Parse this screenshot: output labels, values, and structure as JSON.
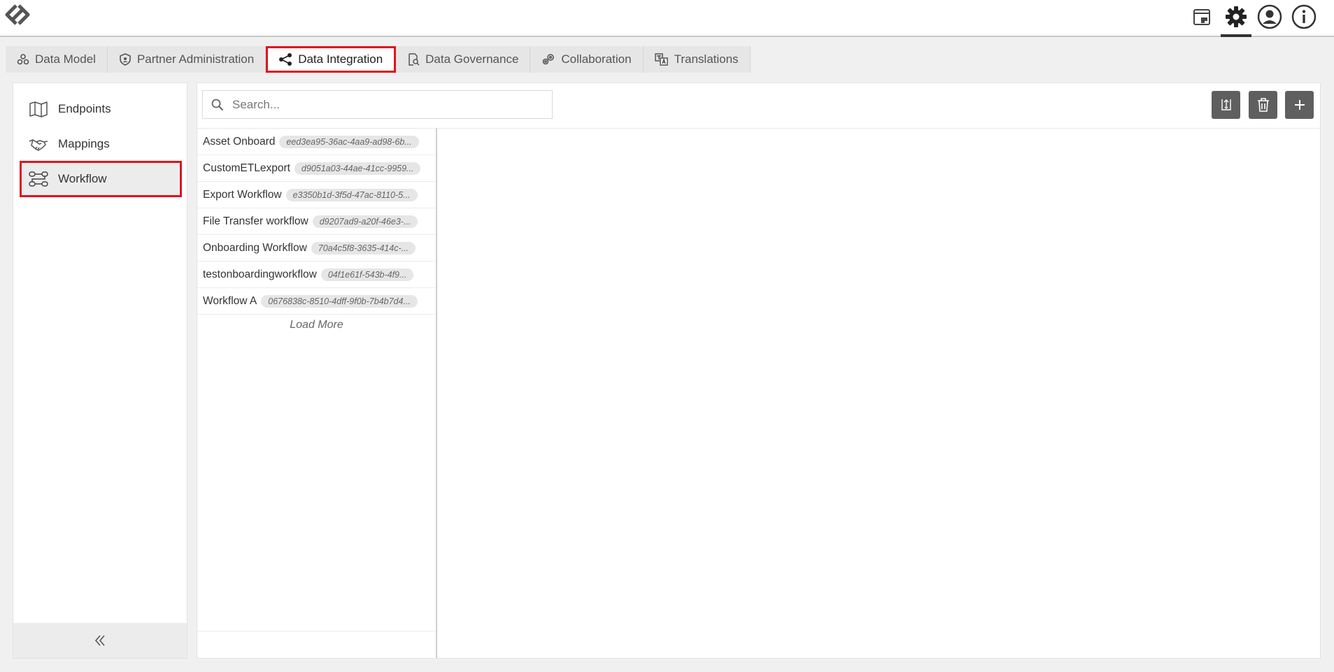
{
  "tabs": [
    {
      "label": "Data Model",
      "icon": "data-model-icon"
    },
    {
      "label": "Partner Administration",
      "icon": "shield-icon"
    },
    {
      "label": "Data Integration",
      "icon": "share-nodes-icon"
    },
    {
      "label": "Data Governance",
      "icon": "document-search-icon"
    },
    {
      "label": "Collaboration",
      "icon": "gears-icon"
    },
    {
      "label": "Translations",
      "icon": "translate-icon"
    }
  ],
  "active_tab": "Data Integration",
  "sidebar": {
    "items": [
      {
        "label": "Endpoints",
        "icon": "map-icon"
      },
      {
        "label": "Mappings",
        "icon": "handshake-icon"
      },
      {
        "label": "Workflow",
        "icon": "workflow-icon"
      }
    ],
    "active_item": "Workflow"
  },
  "search": {
    "placeholder": "Search..."
  },
  "workflows": [
    {
      "name": "Asset Onboard",
      "id": "eed3ea95-36ac-4aa9-ad98-6b..."
    },
    {
      "name": "CustomETLexport",
      "id": "d9051a03-44ae-41cc-9959..."
    },
    {
      "name": "Export Workflow",
      "id": "e3350b1d-3f5d-47ac-8110-5..."
    },
    {
      "name": "File Transfer workflow",
      "id": "d9207ad9-a20f-46e3-..."
    },
    {
      "name": "Onboarding Workflow",
      "id": "70a4c5f8-3635-414c-..."
    },
    {
      "name": "testonboardingworkflow",
      "id": "04f1e61f-543b-4f9..."
    },
    {
      "name": "Workflow A",
      "id": "0676838c-8510-4dff-9f0b-7b4b7d4..."
    }
  ],
  "load_more_label": "Load More",
  "colors": {
    "accent_red": "#e0141e",
    "button_gray": "#5f5f5f"
  }
}
